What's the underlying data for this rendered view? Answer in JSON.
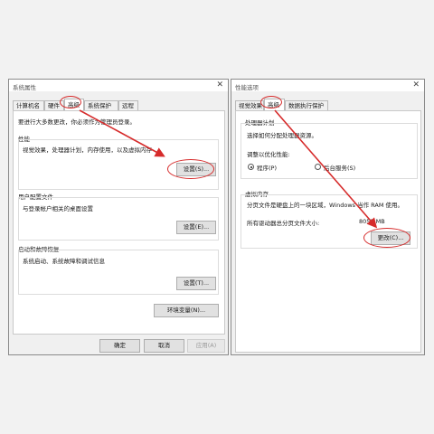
{
  "left_window": {
    "title": "系统属性",
    "tabs": [
      "计算机名",
      "硬件",
      "高级",
      "系统保护",
      "远程"
    ],
    "notice": "要进行大多数更改，你必须作为管理员登录。",
    "perf": {
      "heading": "性能",
      "desc": "视觉效果，处理器计划，内存使用，以及虚拟内存",
      "button": "设置(S)..."
    },
    "profile": {
      "heading": "用户配置文件",
      "desc": "与登录帐户相关的桌面设置",
      "button": "设置(E)..."
    },
    "startup": {
      "heading": "启动和故障恢复",
      "desc": "系统启动、系统故障和调试信息",
      "button": "设置(T)..."
    },
    "env_button": "环境变量(N)...",
    "ok": "确定",
    "cancel": "取消",
    "apply": "应用(A)"
  },
  "right_window": {
    "title": "性能选项",
    "tabs": [
      "视觉效果",
      "高级",
      "数据执行保护"
    ],
    "processor": {
      "heading": "处理器计划",
      "desc": "选择如何分配处理器资源。",
      "adjust_label": "调整以优化性能:",
      "option_programs": "程序(P)",
      "option_background": "后台服务(S)",
      "selected": "程序(P)"
    },
    "virtual_memory": {
      "heading": "虚拟内存",
      "desc": "分页文件是硬盘上的一块区域，Windows 当作 RAM 使用。",
      "total_label": "所有驱动器总分页文件大小:",
      "total_value": "8052 MB",
      "change_button": "更改(C)..."
    }
  },
  "close_glyph": "✕",
  "annotation_color": "#d62b2b"
}
